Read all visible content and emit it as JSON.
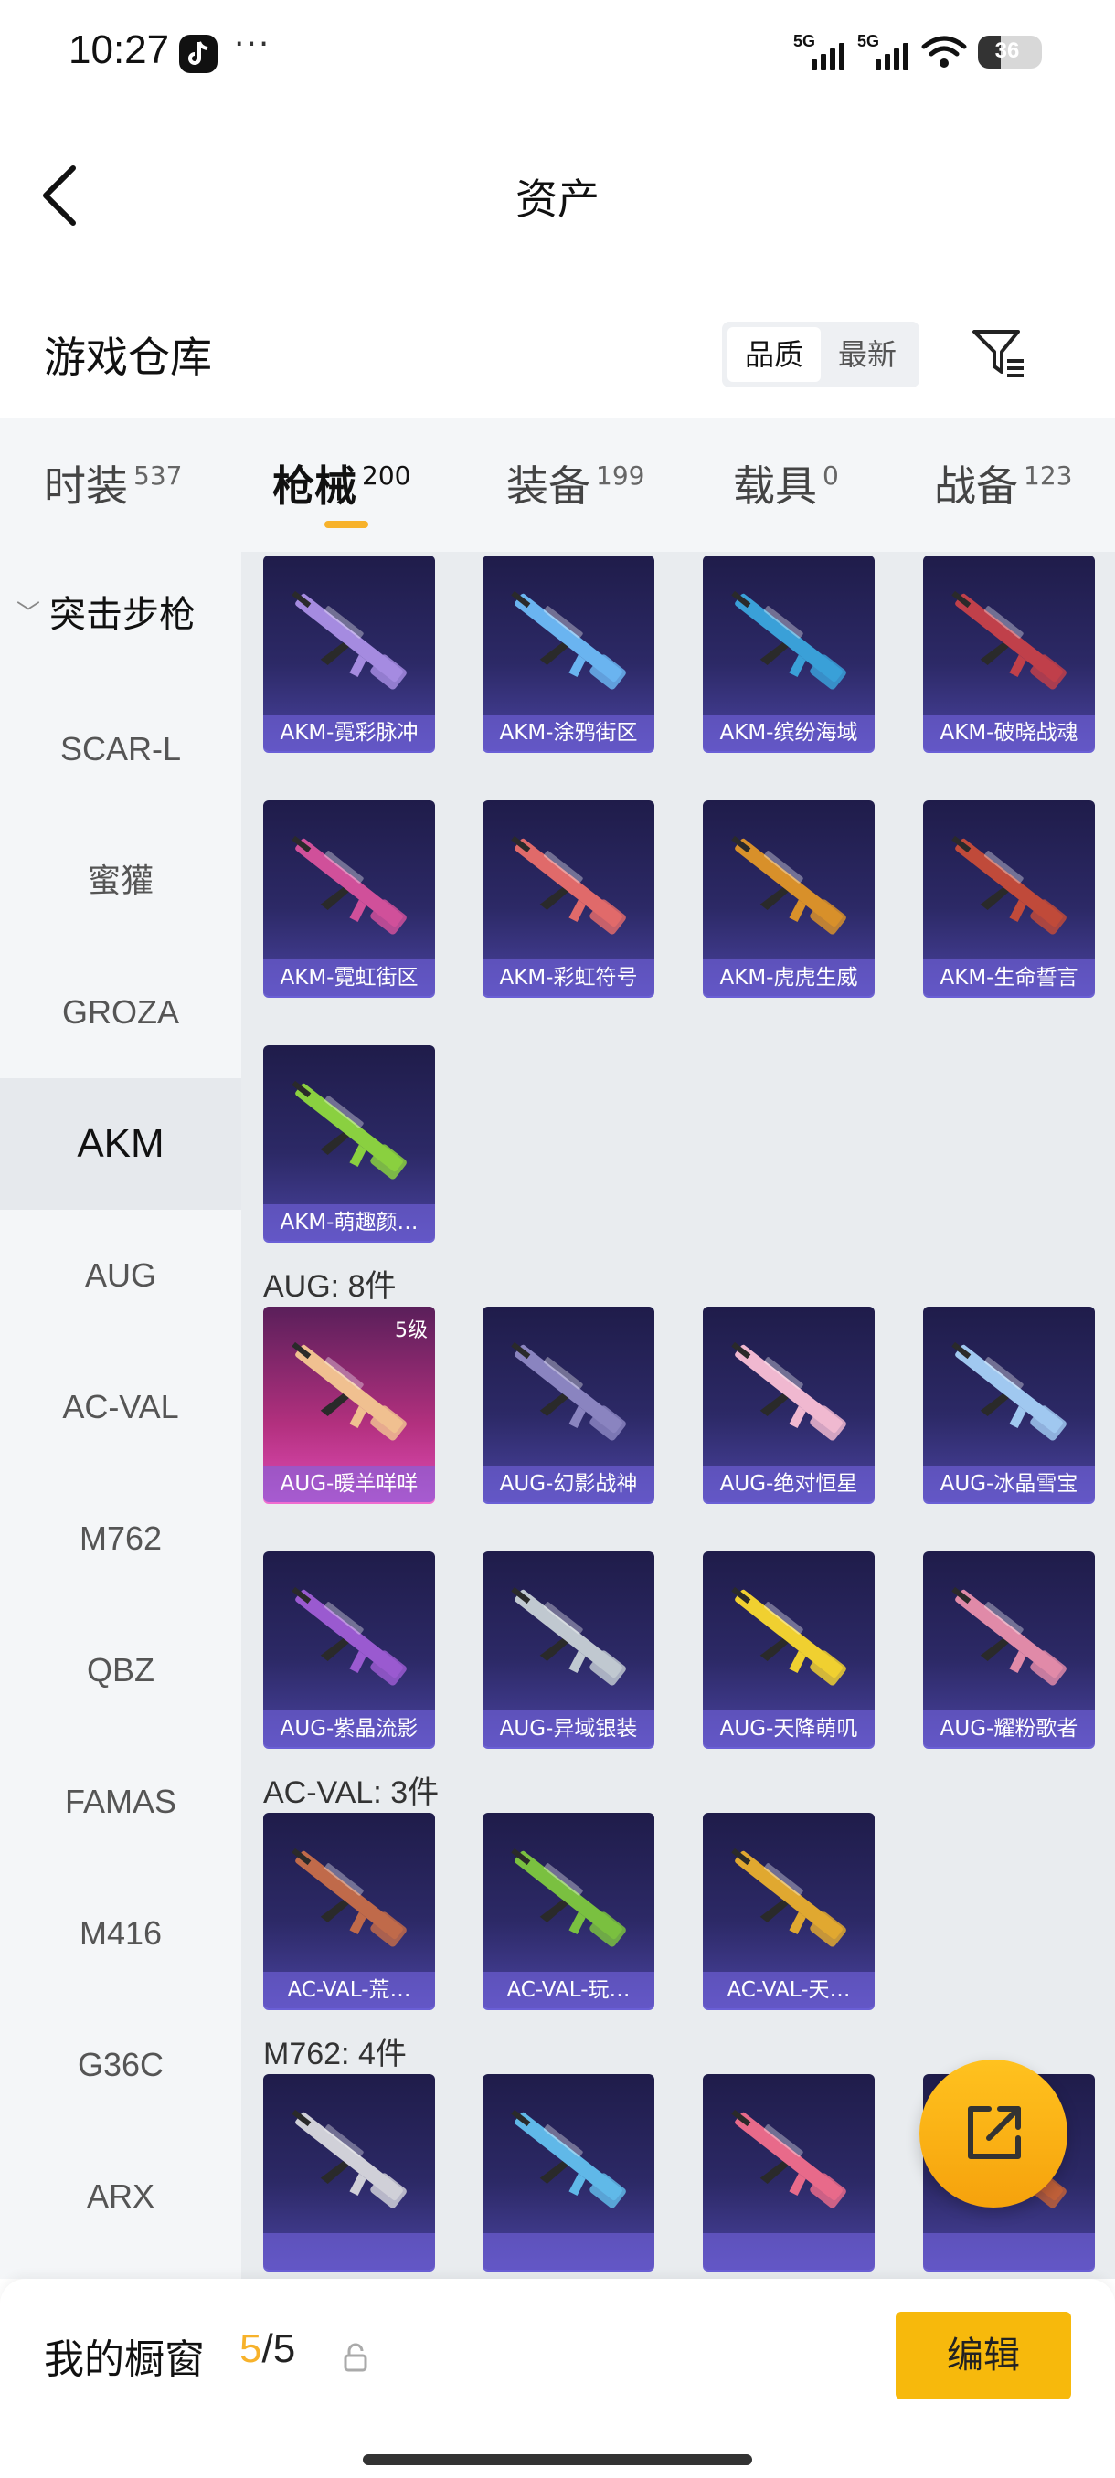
{
  "status_bar": {
    "time": "10:27",
    "dots": "···",
    "signal_1": "5G",
    "signal_2": "5G",
    "battery": "36"
  },
  "header": {
    "title": "资产"
  },
  "section": {
    "title": "游戏仓库",
    "sort_options": [
      "品质",
      "最新"
    ],
    "active_sort": "品质"
  },
  "category_tabs": [
    {
      "label": "时装",
      "count": "537"
    },
    {
      "label": "枪械",
      "count": "200"
    },
    {
      "label": "装备",
      "count": "199"
    },
    {
      "label": "载具",
      "count": "0"
    },
    {
      "label": "战备",
      "count": "123"
    }
  ],
  "active_tab": "枪械",
  "sidebar": {
    "group": "突击步枪",
    "items": [
      "SCAR-L",
      "蜜獾",
      "GROZA",
      "AKM",
      "AUG",
      "AC-VAL",
      "M762",
      "QBZ",
      "FAMAS",
      "M416",
      "G36C",
      "ARX"
    ],
    "active": "AKM"
  },
  "groups": [
    {
      "header": "",
      "items": [
        {
          "name": "AKM-霓彩脉冲",
          "color": "#a58be0"
        },
        {
          "name": "AKM-涂鸦街区",
          "color": "#6ab4f0"
        },
        {
          "name": "AKM-缤纷海域",
          "color": "#3aa0d8"
        },
        {
          "name": "AKM-破晓战魂",
          "color": "#c0404a"
        },
        {
          "name": "AKM-霓虹街区",
          "color": "#d0509a"
        },
        {
          "name": "AKM-彩虹符号",
          "color": "#e06a6a"
        },
        {
          "name": "AKM-虎虎生威",
          "color": "#d8902a"
        },
        {
          "name": "AKM-生命誓言",
          "color": "#c04a3a"
        },
        {
          "name": "AKM-萌趣颜…",
          "color": "#8ad040"
        }
      ]
    },
    {
      "header": "AUG: 8件",
      "items": [
        {
          "name": "AUG-暖羊咩咩",
          "color": "#f0c090",
          "level": "5级"
        },
        {
          "name": "AUG-幻影战神",
          "color": "#8a84c0"
        },
        {
          "name": "AUG-绝对恒星",
          "color": "#f0b8d0"
        },
        {
          "name": "AUG-冰晶雪宝",
          "color": "#a0c8f0"
        },
        {
          "name": "AUG-紫晶流影",
          "color": "#9a5ad0"
        },
        {
          "name": "AUG-异域银装",
          "color": "#c0c8d0"
        },
        {
          "name": "AUG-天降萌叽",
          "color": "#f0d030"
        },
        {
          "name": "AUG-耀粉歌者",
          "color": "#e08aa8"
        }
      ]
    },
    {
      "header": "AC-VAL: 3件",
      "items": [
        {
          "name": "AC-VAL-荒…",
          "color": "#c06a4a"
        },
        {
          "name": "AC-VAL-玩…",
          "color": "#7ac040"
        },
        {
          "name": "AC-VAL-天…",
          "color": "#e0a830"
        }
      ]
    },
    {
      "header": "M762: 4件",
      "items": [
        {
          "name": "",
          "color": "#d0d0d8"
        },
        {
          "name": "",
          "color": "#60b8e8"
        },
        {
          "name": "",
          "color": "#e86a8a"
        },
        {
          "name": "",
          "color": "#c0603a"
        }
      ]
    }
  ],
  "bottom_bar": {
    "label": "我的橱窗",
    "current": "5",
    "separator": "/",
    "total": "5",
    "edit_label": "编辑"
  },
  "colors": {
    "accent": "#f7b22b",
    "edit_button": "#f7b90c"
  }
}
